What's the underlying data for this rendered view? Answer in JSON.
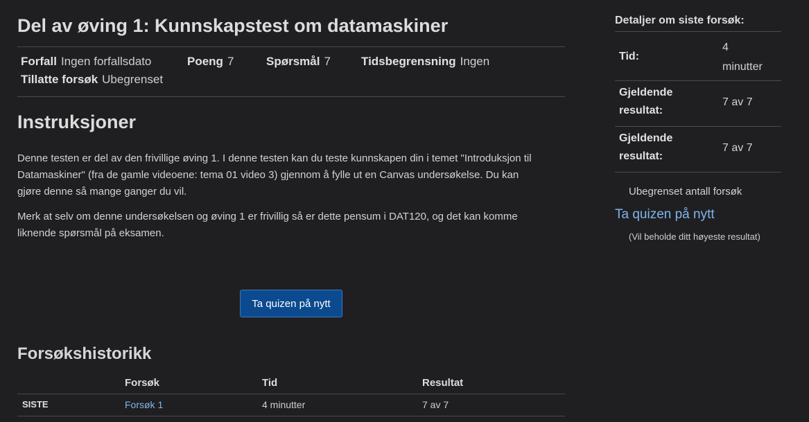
{
  "page": {
    "title": "Del av øving 1: Kunnskapstest om datamaskiner"
  },
  "meta": {
    "due_label": "Forfall",
    "due_value": "Ingen forfallsdato",
    "points_label": "Poeng",
    "points_value": "7",
    "questions_label": "Spørsmål",
    "questions_value": "7",
    "time_limit_label": "Tidsbegrensning",
    "time_limit_value": "Ingen",
    "attempts_label": "Tillatte forsøk",
    "attempts_value": "Ubegrenset"
  },
  "instructions": {
    "heading": "Instruksjoner",
    "paragraph1_line1": "Denne testen er del av den frivillige øving 1. I denne testen kan du teste kunnskapen din i temet \"Introduksjon til",
    "paragraph1_line2": "Datamaskiner\" (fra de gamle videoene: tema 01 video 3) gjennom å fylle ut en Canvas undersøkelse. Du kan",
    "paragraph1_line3": "gjøre denne så mange ganger du vil.",
    "paragraph2_line1": "Merk at selv om denne undersøkelsen og øving 1 er frivillig så er dette pensum i DAT120, og det kan komme",
    "paragraph2_line2": "liknende spørsmål på eksamen."
  },
  "retake_button": {
    "label": "Ta quizen på nytt"
  },
  "history": {
    "heading": "Forsøkshistorikk",
    "columns": [
      "Forsøk",
      "Tid",
      "Resultat"
    ],
    "rows": [
      {
        "label": "SISTE",
        "attempt": "Forsøk 1",
        "time": "4 minutter",
        "result": "7 av 7"
      }
    ]
  },
  "sidebar": {
    "heading": "Detaljer om siste forsøk:",
    "time_label": "Tid:",
    "time_value_line1": "4",
    "time_value_line2": "minutter",
    "current_score_label_line1": "Gjeldende",
    "current_score_label_line2": "resultat:",
    "current_score_value": "7 av 7",
    "kept_score_label_line1": "Gjeldende",
    "kept_score_label_line2": "resultat:",
    "kept_score_value": "7 av 7",
    "unlimited_note": "Ubegrenset antall forsøk",
    "retake_link": "Ta quizen på nytt",
    "retake_sub": "(Vil beholde ditt høyeste resultat)"
  },
  "colors": {
    "background": "#1f1f21",
    "link": "#7fb5ec",
    "primary_button": "#0b4a8f"
  }
}
